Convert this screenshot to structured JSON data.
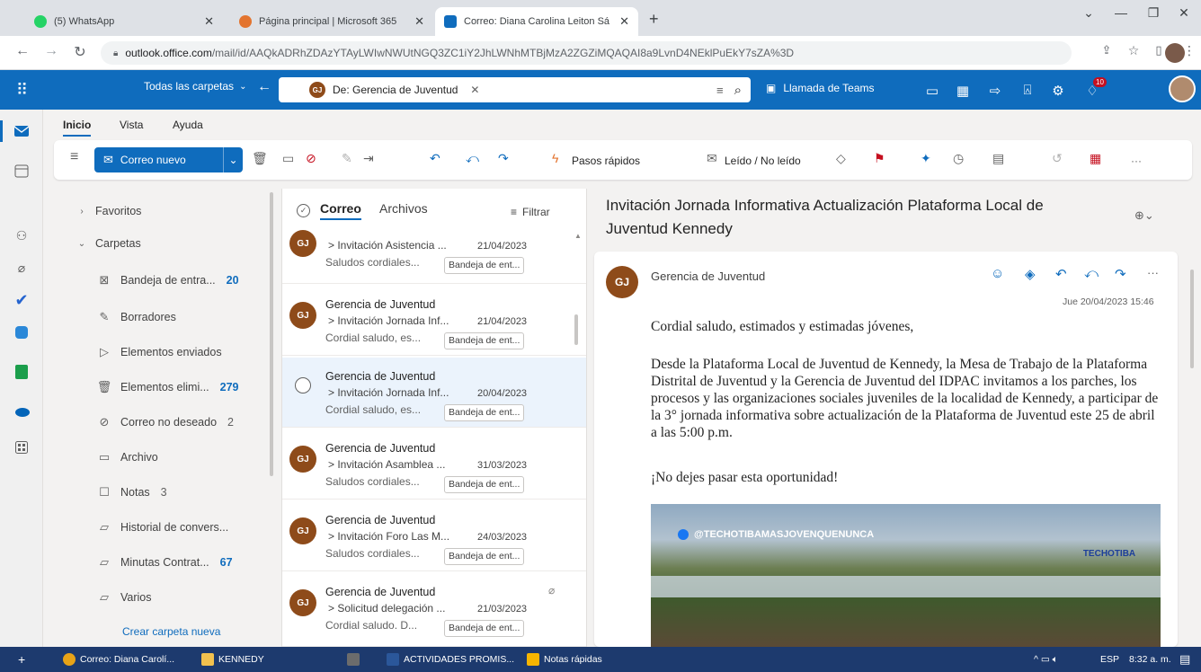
{
  "browser": {
    "tabs": [
      {
        "label": "(5) WhatsApp",
        "color": "#25d366"
      },
      {
        "label": "Página principal | Microsoft 365",
        "color": "#e3742f"
      },
      {
        "label": "Correo: Diana Carolina Leiton Sá",
        "color": "#0f6cbd"
      }
    ],
    "url_host": "outlook.office.com",
    "url_path": "/mail/id/AAQkADRhZDAzYTAyLWIwNWUtNGQ3ZC1iY2JhLWNhMTBjMzA2ZGZiMQAQAI8a9LvnD4NEklPuEkY7sZA%3D"
  },
  "header": {
    "folder_scope": "Todas las carpetas",
    "search_chip_initials": "GJ",
    "search_chip_label": "De: Gerencia de Juventud",
    "teams_label": "Llamada de Teams",
    "notif_count": "10"
  },
  "ribbon": {
    "tabs": [
      "Inicio",
      "Vista",
      "Ayuda"
    ],
    "new_mail": "Correo nuevo",
    "quick_steps": "Pasos rápidos",
    "read_unread": "Leído / No leído",
    "more": "···"
  },
  "folders": {
    "favorites": "Favoritos",
    "folders_header": "Carpetas",
    "items": [
      {
        "name": "Bandeja de entra...",
        "count": "20",
        "icon": "inbox-icon"
      },
      {
        "name": "Borradores",
        "count": "",
        "icon": "drafts-icon"
      },
      {
        "name": "Elementos enviados",
        "count": "",
        "icon": "sent-icon"
      },
      {
        "name": "Elementos elimi...",
        "count": "279",
        "icon": "trash-icon"
      },
      {
        "name": "Correo no deseado",
        "count": "2",
        "icon": "junk-icon"
      },
      {
        "name": "Archivo",
        "count": "",
        "icon": "archive-icon"
      },
      {
        "name": "Notas",
        "count": "3",
        "icon": "notes-icon"
      },
      {
        "name": "Historial de convers...",
        "count": "",
        "icon": "folder-icon"
      },
      {
        "name": "Minutas Contrat...",
        "count": "67",
        "icon": "folder-icon"
      },
      {
        "name": "Varios",
        "count": "",
        "icon": "folder-icon"
      }
    ],
    "create": "Crear carpeta nueva"
  },
  "list": {
    "tab_mail": "Correo",
    "tab_files": "Archivos",
    "filter": "Filtrar",
    "messages": [
      {
        "initials": "GJ",
        "sender": "Gerencia de Juventud",
        "subject": "> Invitación Asistencia ...",
        "date": "21/04/2023",
        "preview": "Saludos cordiales...",
        "badge": "Bandeja de ent..."
      },
      {
        "initials": "GJ",
        "sender": "Gerencia de Juventud",
        "subject": "> Invitación Jornada Inf...",
        "date": "21/04/2023",
        "preview": "Cordial saludo, es...",
        "badge": "Bandeja de ent..."
      },
      {
        "initials": "",
        "sender": "Gerencia de Juventud",
        "subject": "> Invitación Jornada Inf...",
        "date": "20/04/2023",
        "preview": "Cordial saludo, es...",
        "badge": "Bandeja de ent..."
      },
      {
        "initials": "GJ",
        "sender": "Gerencia de Juventud",
        "subject": "> Invitación Asamblea ...",
        "date": "31/03/2023",
        "preview": "Saludos cordiales...",
        "badge": "Bandeja de ent..."
      },
      {
        "initials": "GJ",
        "sender": "Gerencia de Juventud",
        "subject": "> Invitación Foro Las M...",
        "date": "24/03/2023",
        "preview": "Saludos cordiales...",
        "badge": "Bandeja de ent..."
      },
      {
        "initials": "GJ",
        "sender": "Gerencia de Juventud",
        "subject": "> Solicitud delegación ...",
        "date": "21/03/2023",
        "preview": "Cordial saludo. D...",
        "badge": "Bandeja de ent..."
      }
    ]
  },
  "reading": {
    "title": "Invitación Jornada Informativa Actualización Plataforma Local de Juventud Kennedy",
    "sender_initials": "GJ",
    "sender": "Gerencia de Juventud",
    "datetime": "Jue 20/04/2023 15:46",
    "greeting": "Cordial saludo, estimados y estimadas jóvenes,",
    "body": "Desde la Plataforma Local de Juventud de Kennedy, la Mesa de Trabajo de la Plataforma Distrital de Juventud y la Gerencia de Juventud del IDPAC invitamos a los parches, los procesos y las organizaciones sociales juveniles de la localidad de Kennedy, a participar de la 3° jornada informativa sobre actualización de la Plataforma de Juventud este 25 de abril a las 5:00 p.m.",
    "closing": "¡No dejes pasar esta oportunidad!",
    "banner_handle": "@TECHOTIBAMASJOVENQUENUNCA",
    "banner_logo": "TECHOTIBA"
  },
  "taskbar": {
    "items": [
      "Correo: Diana Carolí...",
      "KENNEDY",
      "ACTIVIDADES PROMIS...",
      "Notas rápidas"
    ],
    "lang": "ESP",
    "time": "8:32 a. m."
  },
  "colors": {
    "brand": "#0f6cbd",
    "avatar": "#8e4b1a"
  }
}
